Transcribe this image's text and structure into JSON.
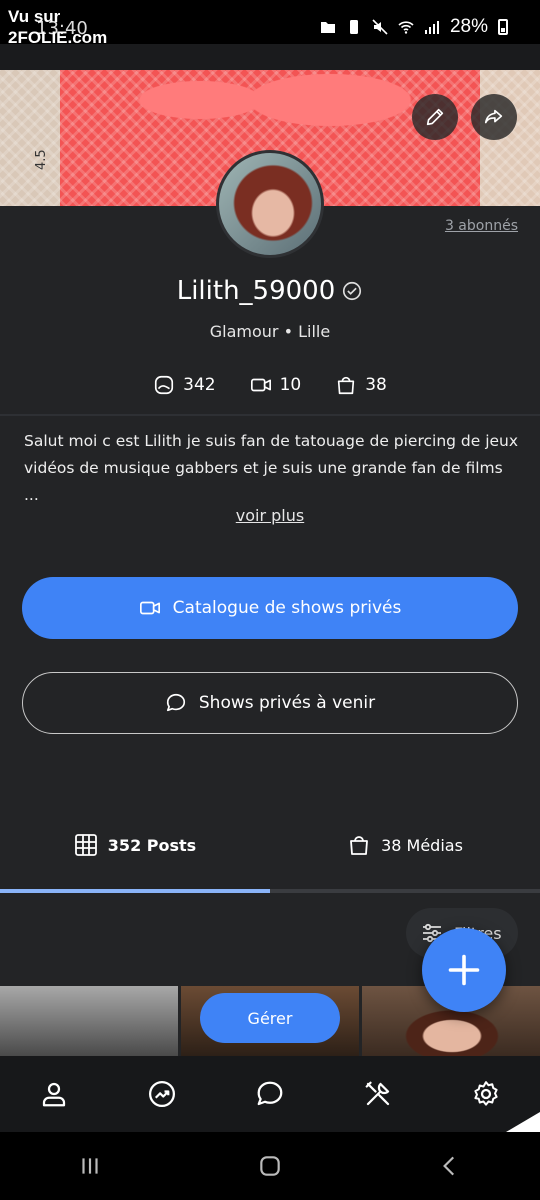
{
  "status_bar": {
    "time": "13:40",
    "battery": "28%",
    "watermark_line1": "Vu sur",
    "watermark_line2": "2FOLIE.com"
  },
  "cover": {
    "age_label": "4.5",
    "edit_icon": "pencil-icon",
    "share_icon": "share-arrow-icon"
  },
  "profile": {
    "followers": "3 abonnés",
    "username": "Lilith_59000",
    "subtitle": "Glamour • Lille",
    "stats": [
      {
        "icon": "photo-icon",
        "value": "342"
      },
      {
        "icon": "video-icon",
        "value": "10"
      },
      {
        "icon": "bag-icon",
        "value": "38"
      }
    ],
    "bio": "Salut moi c est Lilith je suis fan de tatouage de piercing de jeux vidéos de musique gabbers et je suis une grande fan de films ...",
    "see_more": "voir plus"
  },
  "actions": {
    "catalog": "Catalogue de shows privés",
    "upcoming": "Shows privés à venir"
  },
  "tabs": {
    "posts": "352 Posts",
    "medias": "38 Médias"
  },
  "filters_label": "Filtres",
  "manage_label": "Gérer",
  "bottom_nav": [
    "profile-icon",
    "stats-icon",
    "chat-icon",
    "tools-icon",
    "settings-icon"
  ],
  "colors": {
    "accent": "#3f83f6",
    "background": "#232426",
    "nav": "#17181a"
  }
}
